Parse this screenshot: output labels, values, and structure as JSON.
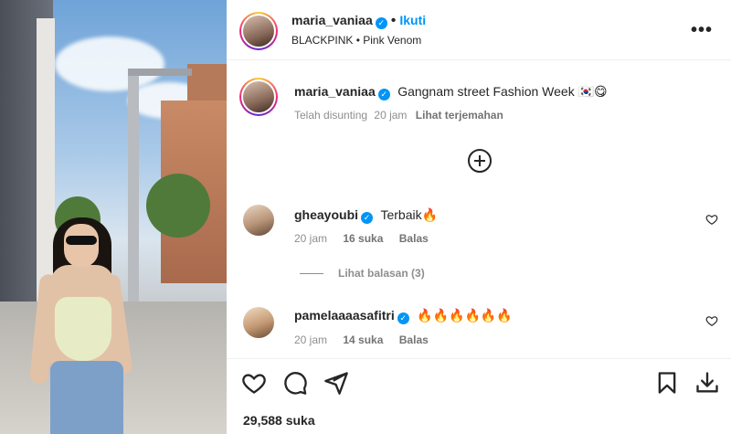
{
  "post": {
    "author": "maria_vaniaa",
    "follow_label": "Ikuti",
    "separator": "•",
    "audio": "BLACKPINK • Pink Venom",
    "more_label": "•••"
  },
  "caption": {
    "author": "maria_vaniaa",
    "text": "Gangnam street Fashion Week 🇰🇷😋",
    "edited": "Telah disunting",
    "time": "20 jam",
    "translate": "Lihat terjemahan"
  },
  "comments": [
    {
      "author": "gheayoubi",
      "text": "Terbaik🔥",
      "time": "20 jam",
      "likes": "16 suka",
      "reply": "Balas",
      "view_replies": "Lihat balasan (3)"
    },
    {
      "author": "pamelaaaasafitri",
      "text": "🔥🔥🔥🔥🔥🔥",
      "time": "20 jam",
      "likes": "14 suka",
      "reply": "Balas"
    }
  ],
  "footer": {
    "likes": "29,588 suka"
  },
  "icons": {
    "like": "heart-icon",
    "comment": "comment-icon",
    "share": "share-icon",
    "save": "bookmark-icon",
    "download": "download-icon",
    "add": "plus-circle-icon",
    "verified": "verified-badge-icon"
  },
  "colors": {
    "accent": "#0095f6",
    "text": "#262626",
    "muted": "#8e8e8e"
  }
}
